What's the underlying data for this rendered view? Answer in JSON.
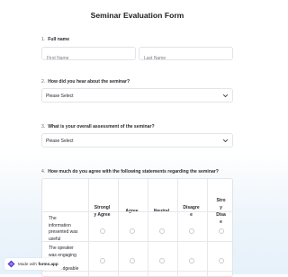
{
  "form": {
    "title": "Seminar Evaluation Form",
    "q1": {
      "number": "1.",
      "label": "Full name",
      "first_placeholder": "First Name",
      "last_placeholder": "Last Name"
    },
    "q2": {
      "number": "2.",
      "label": "How did you hear about the seminar?",
      "selected": "Please Select"
    },
    "q3": {
      "number": "3.",
      "label": "What is your overall assessment of the seminar?",
      "selected": "Please Select"
    },
    "q4": {
      "number": "4.",
      "label": "How much do you agree with the following statements regarding the seminar?",
      "columns": [
        [
          "Strongl",
          "y Agree"
        ],
        [
          "Agree"
        ],
        [
          "Neutral"
        ],
        [
          "Disagre",
          "e"
        ],
        [
          "Stro",
          "y",
          "Disa",
          "e"
        ]
      ],
      "rows": [
        [
          "The",
          "information",
          "presented was",
          "useful"
        ],
        [
          "The speaker",
          "was engaging",
          "and",
          "knowledgeable"
        ]
      ]
    }
  },
  "badge": {
    "prefix": "Made with",
    "brand": "forms.app",
    "logo_color": "#5b3fd6"
  },
  "icons": {
    "chevron": "chevron-down-icon",
    "logo": "forms-app-logo-icon"
  }
}
